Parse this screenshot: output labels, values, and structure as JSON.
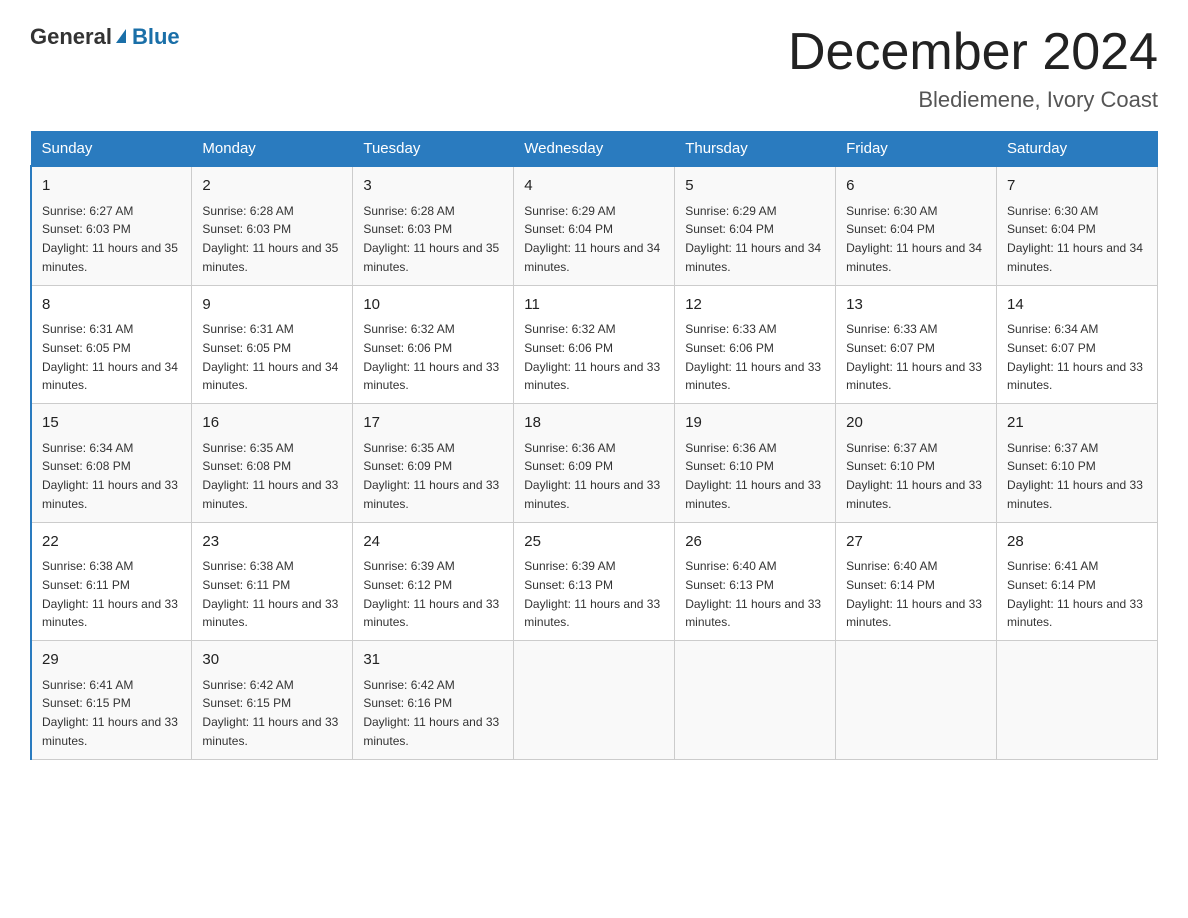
{
  "header": {
    "logo_text_general": "General",
    "logo_text_blue": "Blue",
    "month_title": "December 2024",
    "location": "Blediemene, Ivory Coast"
  },
  "calendar": {
    "days_of_week": [
      "Sunday",
      "Monday",
      "Tuesday",
      "Wednesday",
      "Thursday",
      "Friday",
      "Saturday"
    ],
    "weeks": [
      [
        {
          "day": "1",
          "sunrise": "6:27 AM",
          "sunset": "6:03 PM",
          "daylight": "11 hours and 35 minutes."
        },
        {
          "day": "2",
          "sunrise": "6:28 AM",
          "sunset": "6:03 PM",
          "daylight": "11 hours and 35 minutes."
        },
        {
          "day": "3",
          "sunrise": "6:28 AM",
          "sunset": "6:03 PM",
          "daylight": "11 hours and 35 minutes."
        },
        {
          "day": "4",
          "sunrise": "6:29 AM",
          "sunset": "6:04 PM",
          "daylight": "11 hours and 34 minutes."
        },
        {
          "day": "5",
          "sunrise": "6:29 AM",
          "sunset": "6:04 PM",
          "daylight": "11 hours and 34 minutes."
        },
        {
          "day": "6",
          "sunrise": "6:30 AM",
          "sunset": "6:04 PM",
          "daylight": "11 hours and 34 minutes."
        },
        {
          "day": "7",
          "sunrise": "6:30 AM",
          "sunset": "6:04 PM",
          "daylight": "11 hours and 34 minutes."
        }
      ],
      [
        {
          "day": "8",
          "sunrise": "6:31 AM",
          "sunset": "6:05 PM",
          "daylight": "11 hours and 34 minutes."
        },
        {
          "day": "9",
          "sunrise": "6:31 AM",
          "sunset": "6:05 PM",
          "daylight": "11 hours and 34 minutes."
        },
        {
          "day": "10",
          "sunrise": "6:32 AM",
          "sunset": "6:06 PM",
          "daylight": "11 hours and 33 minutes."
        },
        {
          "day": "11",
          "sunrise": "6:32 AM",
          "sunset": "6:06 PM",
          "daylight": "11 hours and 33 minutes."
        },
        {
          "day": "12",
          "sunrise": "6:33 AM",
          "sunset": "6:06 PM",
          "daylight": "11 hours and 33 minutes."
        },
        {
          "day": "13",
          "sunrise": "6:33 AM",
          "sunset": "6:07 PM",
          "daylight": "11 hours and 33 minutes."
        },
        {
          "day": "14",
          "sunrise": "6:34 AM",
          "sunset": "6:07 PM",
          "daylight": "11 hours and 33 minutes."
        }
      ],
      [
        {
          "day": "15",
          "sunrise": "6:34 AM",
          "sunset": "6:08 PM",
          "daylight": "11 hours and 33 minutes."
        },
        {
          "day": "16",
          "sunrise": "6:35 AM",
          "sunset": "6:08 PM",
          "daylight": "11 hours and 33 minutes."
        },
        {
          "day": "17",
          "sunrise": "6:35 AM",
          "sunset": "6:09 PM",
          "daylight": "11 hours and 33 minutes."
        },
        {
          "day": "18",
          "sunrise": "6:36 AM",
          "sunset": "6:09 PM",
          "daylight": "11 hours and 33 minutes."
        },
        {
          "day": "19",
          "sunrise": "6:36 AM",
          "sunset": "6:10 PM",
          "daylight": "11 hours and 33 minutes."
        },
        {
          "day": "20",
          "sunrise": "6:37 AM",
          "sunset": "6:10 PM",
          "daylight": "11 hours and 33 minutes."
        },
        {
          "day": "21",
          "sunrise": "6:37 AM",
          "sunset": "6:10 PM",
          "daylight": "11 hours and 33 minutes."
        }
      ],
      [
        {
          "day": "22",
          "sunrise": "6:38 AM",
          "sunset": "6:11 PM",
          "daylight": "11 hours and 33 minutes."
        },
        {
          "day": "23",
          "sunrise": "6:38 AM",
          "sunset": "6:11 PM",
          "daylight": "11 hours and 33 minutes."
        },
        {
          "day": "24",
          "sunrise": "6:39 AM",
          "sunset": "6:12 PM",
          "daylight": "11 hours and 33 minutes."
        },
        {
          "day": "25",
          "sunrise": "6:39 AM",
          "sunset": "6:13 PM",
          "daylight": "11 hours and 33 minutes."
        },
        {
          "day": "26",
          "sunrise": "6:40 AM",
          "sunset": "6:13 PM",
          "daylight": "11 hours and 33 minutes."
        },
        {
          "day": "27",
          "sunrise": "6:40 AM",
          "sunset": "6:14 PM",
          "daylight": "11 hours and 33 minutes."
        },
        {
          "day": "28",
          "sunrise": "6:41 AM",
          "sunset": "6:14 PM",
          "daylight": "11 hours and 33 minutes."
        }
      ],
      [
        {
          "day": "29",
          "sunrise": "6:41 AM",
          "sunset": "6:15 PM",
          "daylight": "11 hours and 33 minutes."
        },
        {
          "day": "30",
          "sunrise": "6:42 AM",
          "sunset": "6:15 PM",
          "daylight": "11 hours and 33 minutes."
        },
        {
          "day": "31",
          "sunrise": "6:42 AM",
          "sunset": "6:16 PM",
          "daylight": "11 hours and 33 minutes."
        },
        null,
        null,
        null,
        null
      ]
    ],
    "labels": {
      "sunrise": "Sunrise:",
      "sunset": "Sunset:",
      "daylight": "Daylight:"
    }
  }
}
